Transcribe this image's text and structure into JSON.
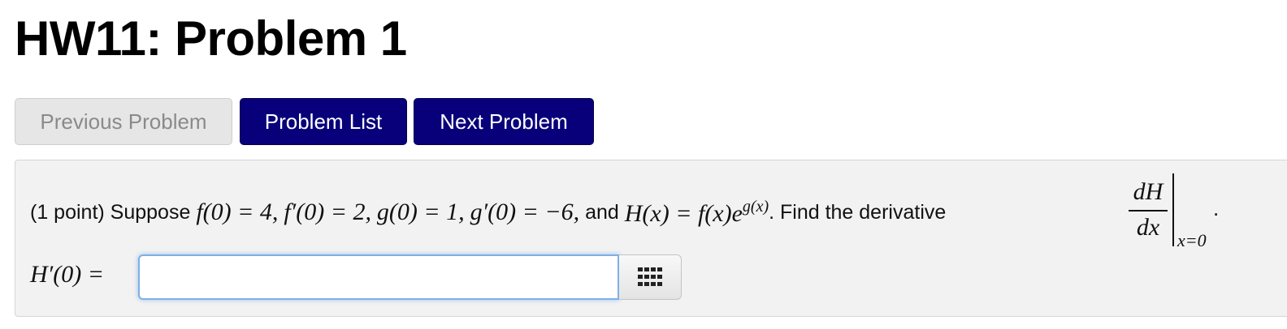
{
  "page": {
    "title": "HW11: Problem 1"
  },
  "nav": {
    "previous_label": "Previous Problem",
    "list_label": "Problem List",
    "next_label": "Next Problem",
    "colors": {
      "primary": "#08007a",
      "disabled": "#e6e6e6"
    }
  },
  "problem": {
    "points": "(1 point) Suppose",
    "math_f0": "f(0) = 4,",
    "math_fp0": "f′(0) = 2,",
    "math_g0": "g(0) = 1,",
    "math_gp0": "g′(0) = −6,",
    "text_and": "and",
    "math_H_def": "H(x) = f(x)e",
    "math_H_exp": "g(x)",
    "text_find": ". Find the derivative",
    "frac_num": "dH",
    "frac_den": "dx",
    "eval_at": "x=0",
    "period": "."
  },
  "answer": {
    "label": "H′(0) =",
    "value": "",
    "palette_icon": "grid-keypad-icon"
  }
}
